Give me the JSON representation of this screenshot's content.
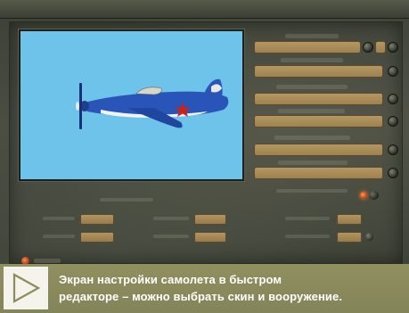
{
  "caption": {
    "line1": "Экран настройки самолета в быстром",
    "line2": "редакторе – можно выбрать скин и вооружение."
  },
  "icons": {
    "caption_icon": "play-triangle-icon"
  },
  "colors": {
    "sky": "#6ec3ea",
    "field": "#b49762",
    "caption_bg": "#8c8c5c",
    "led": "#ff7a2a"
  }
}
